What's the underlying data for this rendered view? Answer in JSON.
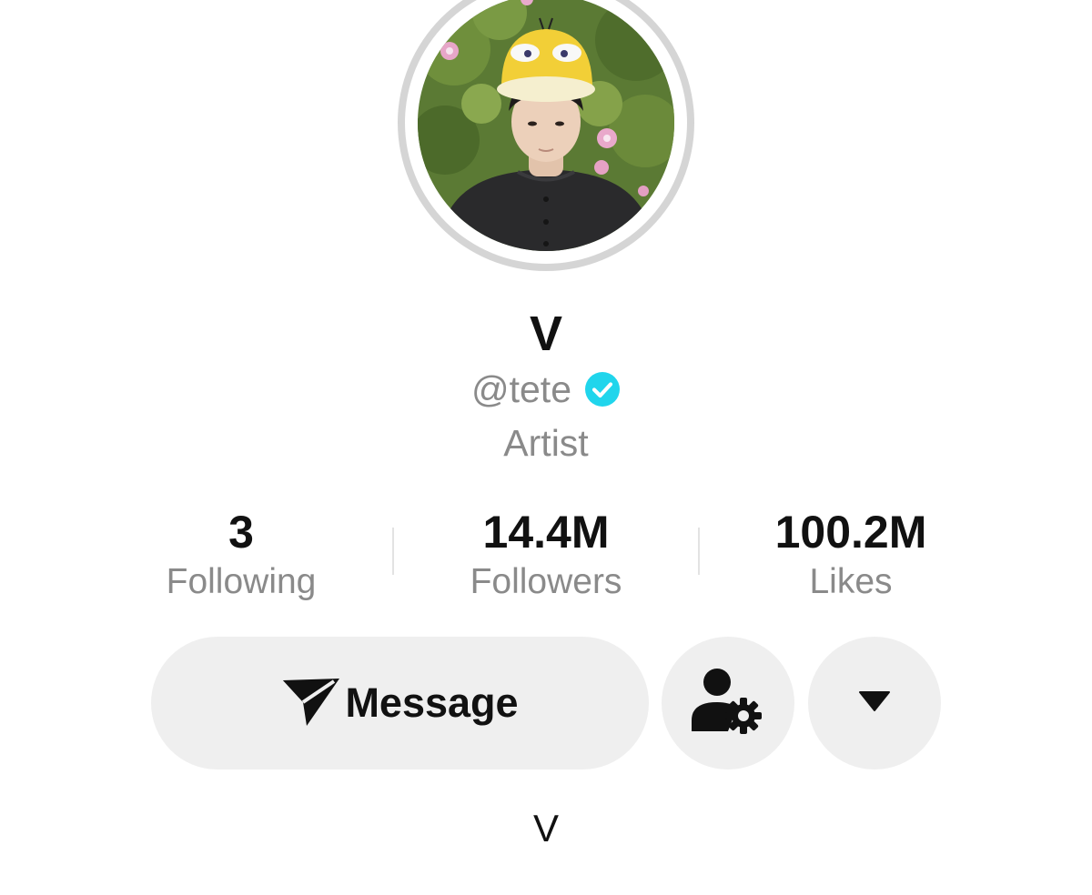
{
  "profile": {
    "display_name": "V",
    "handle": "@tete",
    "category": "Artist",
    "bio": "V",
    "avatar_icon": "profile-photo"
  },
  "stats": {
    "following": {
      "value": "3",
      "label": "Following"
    },
    "followers": {
      "value": "14.4M",
      "label": "Followers"
    },
    "likes": {
      "value": "100.2M",
      "label": "Likes"
    }
  },
  "actions": {
    "message_label": "Message",
    "message_icon": "send-icon",
    "follow_settings_icon": "person-gear-icon",
    "more_icon": "caret-down-icon"
  },
  "colors": {
    "verified": "#20d5ec",
    "muted_text": "#8a8a8a",
    "button_bg": "#efefef",
    "avatar_ring": "#d5d5d5"
  }
}
